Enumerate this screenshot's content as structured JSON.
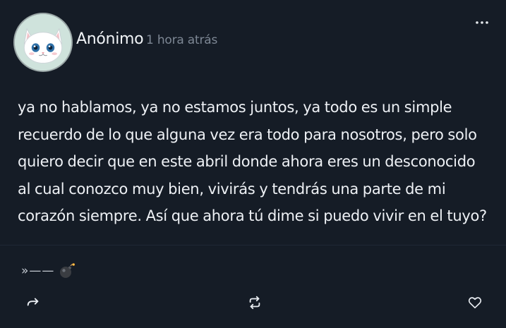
{
  "post": {
    "author": "Anónimo",
    "time": "1 hora atrás",
    "text": "ya no hablamos, ya no estamos juntos, ya todo es un simple recuerdo de lo que alguna vez era todo para nosotros, pero solo quiero decir que en este abril donde ahora eres un desconocido al cual conozco muy bien, vivirás y tendrás una parte de mi corazón siempre. Así que ahora tú dime si puedo vivir en el tuyo?",
    "signature": "»——"
  },
  "icons": {
    "avatar": "white-cat-avatar",
    "more": "more-dots-icon",
    "signature_emoji": "bomb-icon",
    "share": "share-arrow-icon",
    "repost": "repost-icon",
    "like": "heart-icon"
  },
  "colors": {
    "background": "#151c26",
    "text": "#eef1f5",
    "muted": "#7d8794",
    "avatar_bg": "#cfe3dc"
  }
}
